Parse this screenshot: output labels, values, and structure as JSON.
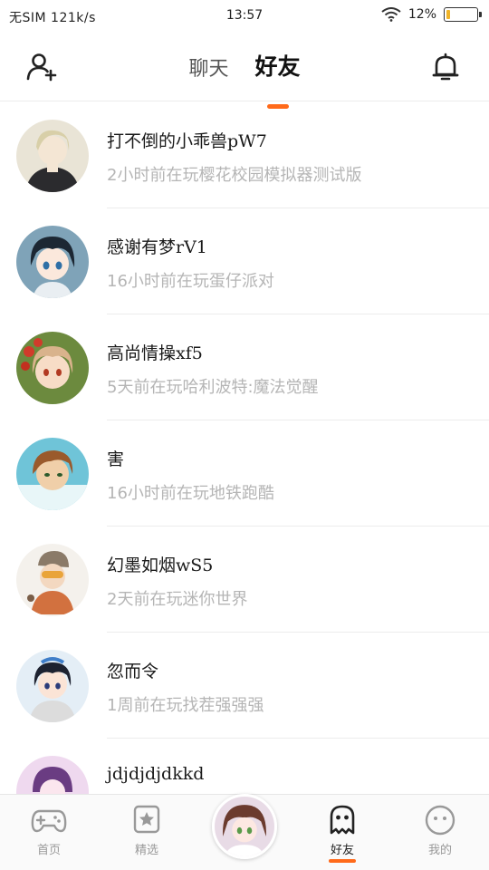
{
  "status_bar": {
    "carrier": "无SIM 121k/s",
    "time": "13:57",
    "battery_text": "12%",
    "battery_level": 0.12
  },
  "header": {
    "add_friend_icon": "add-user-icon",
    "bell_icon": "bell-icon",
    "tabs": [
      {
        "label": "聊天",
        "active": false
      },
      {
        "label": "好友",
        "active": true
      }
    ],
    "accent_color": "#ff6a1a"
  },
  "friends": [
    {
      "name": "打不倒的小乖兽pW7",
      "status": "2小时前在玩樱花校园模拟器测试版"
    },
    {
      "name": "感谢有梦rV1",
      "status": "16小时前在玩蛋仔派对"
    },
    {
      "name": "高尚情操xf5",
      "status": "5天前在玩哈利波特:魔法觉醒"
    },
    {
      "name": "害",
      "status": "16小时前在玩地铁跑酷"
    },
    {
      "name": "幻墨如烟wS5",
      "status": "2天前在玩迷你世界"
    },
    {
      "name": "忽而令",
      "status": "1周前在玩找茬强强强"
    },
    {
      "name": "jdjdjdjdkkd",
      "status": ""
    }
  ],
  "bottom_nav": {
    "items": [
      {
        "label": "首页",
        "icon": "gamepad-icon"
      },
      {
        "label": "精选",
        "icon": "star-icon"
      },
      {
        "label": "好友",
        "icon": "ghost-icon",
        "active": true
      },
      {
        "label": "我的",
        "icon": "face-icon"
      }
    ]
  }
}
